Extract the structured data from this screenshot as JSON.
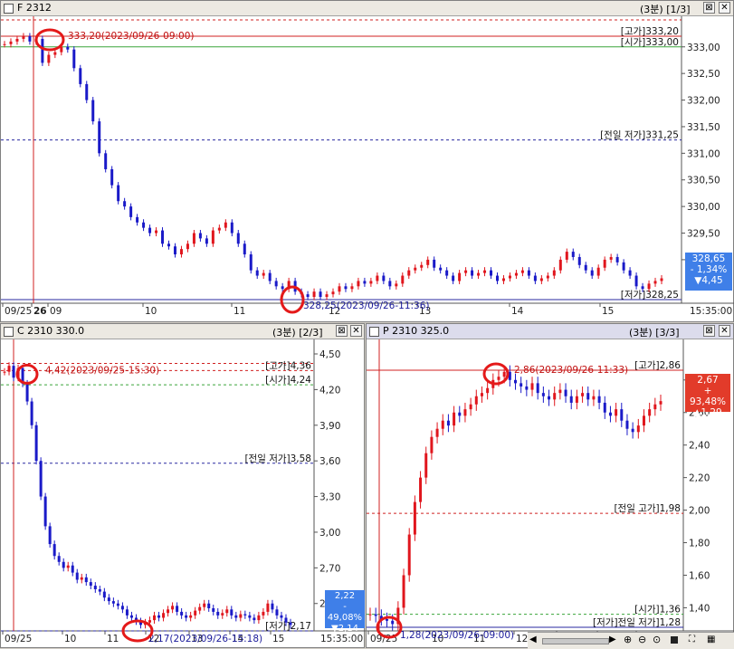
{
  "panels": [
    {
      "title": "F 2312",
      "page": "(3분) [1/3]",
      "yticks": [
        "333,00",
        "332,50",
        "332,00",
        "331,50",
        "331,00",
        "330,50",
        "330,00",
        "329,50",
        "329,00"
      ],
      "xticks": [
        "09/25",
        "26",
        "09",
        "10",
        "11",
        "12",
        "13",
        "14",
        "15"
      ],
      "time_label": "15:35:00",
      "high_annot": "333,20(2023/09/26-09:00)",
      "low_annot": "328,25(2023/09/26-11:36)",
      "level_labels": [
        "[고가]333,20",
        "[시가]333,00",
        "[전일 저가]331,25",
        "[저가]328,25"
      ],
      "price": "328,65",
      "change_pct": "- 1,34%",
      "change_abs": "▼4,45"
    },
    {
      "title": "C 2310 330.0",
      "page": "(3분) [2/3]",
      "yticks": [
        "4,50",
        "4,20",
        "3,90",
        "3,60",
        "3,30",
        "3,00",
        "2,70",
        "2,40"
      ],
      "xticks": [
        "09/25",
        "10",
        "11",
        "12",
        "13",
        "14",
        "15"
      ],
      "time_label": "15:35:00",
      "high_annot": "4,42(2023/09/25-15:30)",
      "low_annot": "2,17(2023/09/26-15:18)",
      "level_labels": [
        "[고가]4,36",
        "[시가]4,24",
        "[전일 저가]3,58",
        "[저가]2,17"
      ],
      "price": "2,22",
      "change_pct": "- 49,08%",
      "change_abs": "▼2,14"
    },
    {
      "title": "P 2310 325.0",
      "page": "(3분) [3/3]",
      "yticks": [
        "2,80",
        "2,60",
        "2,40",
        "2,20",
        "2,00",
        "1,80",
        "1,60",
        "1,40"
      ],
      "xticks": [
        "09/25",
        "10",
        "11",
        "12",
        "13",
        "14",
        "15"
      ],
      "time_label": "15:35:00",
      "high_annot": "2,86(2023/09/26-11:33)",
      "low_annot": "1,28(2023/09/26-09:00)",
      "level_labels": [
        "[고가]2,86",
        "[전일 고가]1,98",
        "[시가]1,36",
        "[저가]전일 저가]1,28"
      ],
      "price": "2,67",
      "change_pct": "+ 93,48%",
      "change_abs": "▲1,29"
    }
  ],
  "colors": {
    "up": "#e0161d",
    "down": "#1a1ac8",
    "badge_down": "#3f7fe8",
    "badge_up": "#e23b2a",
    "high_line": "#d02020",
    "open_line": "#3aa53a",
    "prevlow_line": "#2a2aa0",
    "circle": "#e41919"
  },
  "series": {
    "fut": [
      333.05,
      333.1,
      333.15,
      333.2,
      333.1,
      333.15,
      332.7,
      332.85,
      332.9,
      333.0,
      332.95,
      332.6,
      332.3,
      332.0,
      331.6,
      331.0,
      330.7,
      330.4,
      330.1,
      330.0,
      329.8,
      329.7,
      329.6,
      329.5,
      329.55,
      329.3,
      329.25,
      329.1,
      329.2,
      329.3,
      329.5,
      329.4,
      329.3,
      329.55,
      329.6,
      329.7,
      329.5,
      329.3,
      329.1,
      328.8,
      328.7,
      328.75,
      328.6,
      328.5,
      328.45,
      328.6,
      328.4,
      328.35,
      328.3,
      328.4,
      328.3,
      328.35,
      328.4,
      328.5,
      328.45,
      328.5,
      328.6,
      328.55,
      328.6,
      328.7,
      328.6,
      328.5,
      328.55,
      328.7,
      328.8,
      328.85,
      328.9,
      329.0,
      328.85,
      328.8,
      328.7,
      328.6,
      328.75,
      328.8,
      328.7,
      328.75,
      328.8,
      328.7,
      328.6,
      328.65,
      328.7,
      328.75,
      328.8,
      328.7,
      328.6,
      328.65,
      328.7,
      328.8,
      329.0,
      329.15,
      329.05,
      328.9,
      328.8,
      328.7,
      328.85,
      329.0,
      329.05,
      328.95,
      328.8,
      328.7,
      328.5,
      328.45,
      328.55,
      328.6,
      328.65
    ],
    "call": [
      4.35,
      4.4,
      4.3,
      4.38,
      4.25,
      4.1,
      3.9,
      3.6,
      3.3,
      3.05,
      2.9,
      2.8,
      2.75,
      2.7,
      2.72,
      2.66,
      2.6,
      2.62,
      2.58,
      2.55,
      2.52,
      2.5,
      2.45,
      2.42,
      2.4,
      2.38,
      2.35,
      2.3,
      2.28,
      2.25,
      2.22,
      2.24,
      2.26,
      2.3,
      2.28,
      2.32,
      2.35,
      2.38,
      2.33,
      2.3,
      2.28,
      2.3,
      2.34,
      2.37,
      2.4,
      2.36,
      2.33,
      2.3,
      2.32,
      2.35,
      2.3,
      2.28,
      2.31,
      2.3,
      2.28,
      2.26,
      2.3,
      2.33,
      2.4,
      2.35,
      2.3,
      2.28,
      2.24,
      2.22
    ],
    "put": [
      1.36,
      1.35,
      1.33,
      1.32,
      1.3,
      1.4,
      1.6,
      1.85,
      2.05,
      2.2,
      2.35,
      2.45,
      2.5,
      2.55,
      2.52,
      2.6,
      2.58,
      2.62,
      2.65,
      2.7,
      2.72,
      2.75,
      2.8,
      2.82,
      2.85,
      2.8,
      2.78,
      2.76,
      2.74,
      2.78,
      2.72,
      2.7,
      2.68,
      2.72,
      2.74,
      2.7,
      2.66,
      2.7,
      2.72,
      2.68,
      2.7,
      2.66,
      2.6,
      2.58,
      2.62,
      2.55,
      2.5,
      2.48,
      2.52,
      2.58,
      2.62,
      2.65,
      2.67
    ]
  }
}
